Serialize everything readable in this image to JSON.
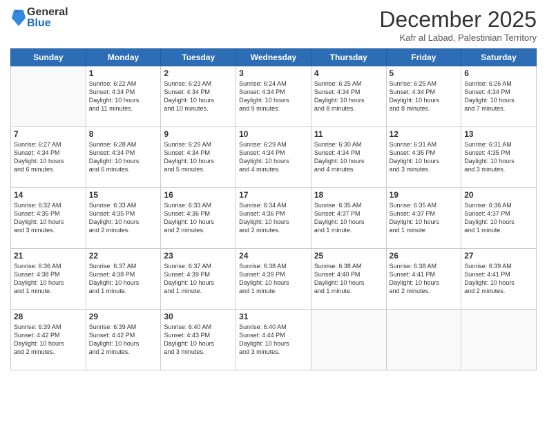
{
  "logo": {
    "general": "General",
    "blue": "Blue"
  },
  "title": "December 2025",
  "location": "Kafr al Labad, Palestinian Territory",
  "days_header": [
    "Sunday",
    "Monday",
    "Tuesday",
    "Wednesday",
    "Thursday",
    "Friday",
    "Saturday"
  ],
  "weeks": [
    [
      {
        "day": "",
        "info": ""
      },
      {
        "day": "1",
        "info": "Sunrise: 6:22 AM\nSunset: 4:34 PM\nDaylight: 10 hours\nand 11 minutes."
      },
      {
        "day": "2",
        "info": "Sunrise: 6:23 AM\nSunset: 4:34 PM\nDaylight: 10 hours\nand 10 minutes."
      },
      {
        "day": "3",
        "info": "Sunrise: 6:24 AM\nSunset: 4:34 PM\nDaylight: 10 hours\nand 9 minutes."
      },
      {
        "day": "4",
        "info": "Sunrise: 6:25 AM\nSunset: 4:34 PM\nDaylight: 10 hours\nand 8 minutes."
      },
      {
        "day": "5",
        "info": "Sunrise: 6:25 AM\nSunset: 4:34 PM\nDaylight: 10 hours\nand 8 minutes."
      },
      {
        "day": "6",
        "info": "Sunrise: 6:26 AM\nSunset: 4:34 PM\nDaylight: 10 hours\nand 7 minutes."
      }
    ],
    [
      {
        "day": "7",
        "info": "Sunrise: 6:27 AM\nSunset: 4:34 PM\nDaylight: 10 hours\nand 6 minutes."
      },
      {
        "day": "8",
        "info": "Sunrise: 6:28 AM\nSunset: 4:34 PM\nDaylight: 10 hours\nand 6 minutes."
      },
      {
        "day": "9",
        "info": "Sunrise: 6:29 AM\nSunset: 4:34 PM\nDaylight: 10 hours\nand 5 minutes."
      },
      {
        "day": "10",
        "info": "Sunrise: 6:29 AM\nSunset: 4:34 PM\nDaylight: 10 hours\nand 4 minutes."
      },
      {
        "day": "11",
        "info": "Sunrise: 6:30 AM\nSunset: 4:34 PM\nDaylight: 10 hours\nand 4 minutes."
      },
      {
        "day": "12",
        "info": "Sunrise: 6:31 AM\nSunset: 4:35 PM\nDaylight: 10 hours\nand 3 minutes."
      },
      {
        "day": "13",
        "info": "Sunrise: 6:31 AM\nSunset: 4:35 PM\nDaylight: 10 hours\nand 3 minutes."
      }
    ],
    [
      {
        "day": "14",
        "info": "Sunrise: 6:32 AM\nSunset: 4:35 PM\nDaylight: 10 hours\nand 3 minutes."
      },
      {
        "day": "15",
        "info": "Sunrise: 6:33 AM\nSunset: 4:35 PM\nDaylight: 10 hours\nand 2 minutes."
      },
      {
        "day": "16",
        "info": "Sunrise: 6:33 AM\nSunset: 4:36 PM\nDaylight: 10 hours\nand 2 minutes."
      },
      {
        "day": "17",
        "info": "Sunrise: 6:34 AM\nSunset: 4:36 PM\nDaylight: 10 hours\nand 2 minutes."
      },
      {
        "day": "18",
        "info": "Sunrise: 6:35 AM\nSunset: 4:37 PM\nDaylight: 10 hours\nand 1 minute."
      },
      {
        "day": "19",
        "info": "Sunrise: 6:35 AM\nSunset: 4:37 PM\nDaylight: 10 hours\nand 1 minute."
      },
      {
        "day": "20",
        "info": "Sunrise: 6:36 AM\nSunset: 4:37 PM\nDaylight: 10 hours\nand 1 minute."
      }
    ],
    [
      {
        "day": "21",
        "info": "Sunrise: 6:36 AM\nSunset: 4:38 PM\nDaylight: 10 hours\nand 1 minute."
      },
      {
        "day": "22",
        "info": "Sunrise: 6:37 AM\nSunset: 4:38 PM\nDaylight: 10 hours\nand 1 minute."
      },
      {
        "day": "23",
        "info": "Sunrise: 6:37 AM\nSunset: 4:39 PM\nDaylight: 10 hours\nand 1 minute."
      },
      {
        "day": "24",
        "info": "Sunrise: 6:38 AM\nSunset: 4:39 PM\nDaylight: 10 hours\nand 1 minute."
      },
      {
        "day": "25",
        "info": "Sunrise: 6:38 AM\nSunset: 4:40 PM\nDaylight: 10 hours\nand 1 minute."
      },
      {
        "day": "26",
        "info": "Sunrise: 6:38 AM\nSunset: 4:41 PM\nDaylight: 10 hours\nand 2 minutes."
      },
      {
        "day": "27",
        "info": "Sunrise: 6:39 AM\nSunset: 4:41 PM\nDaylight: 10 hours\nand 2 minutes."
      }
    ],
    [
      {
        "day": "28",
        "info": "Sunrise: 6:39 AM\nSunset: 4:42 PM\nDaylight: 10 hours\nand 2 minutes."
      },
      {
        "day": "29",
        "info": "Sunrise: 6:39 AM\nSunset: 4:42 PM\nDaylight: 10 hours\nand 2 minutes."
      },
      {
        "day": "30",
        "info": "Sunrise: 6:40 AM\nSunset: 4:43 PM\nDaylight: 10 hours\nand 3 minutes."
      },
      {
        "day": "31",
        "info": "Sunrise: 6:40 AM\nSunset: 4:44 PM\nDaylight: 10 hours\nand 3 minutes."
      },
      {
        "day": "",
        "info": ""
      },
      {
        "day": "",
        "info": ""
      },
      {
        "day": "",
        "info": ""
      }
    ]
  ]
}
